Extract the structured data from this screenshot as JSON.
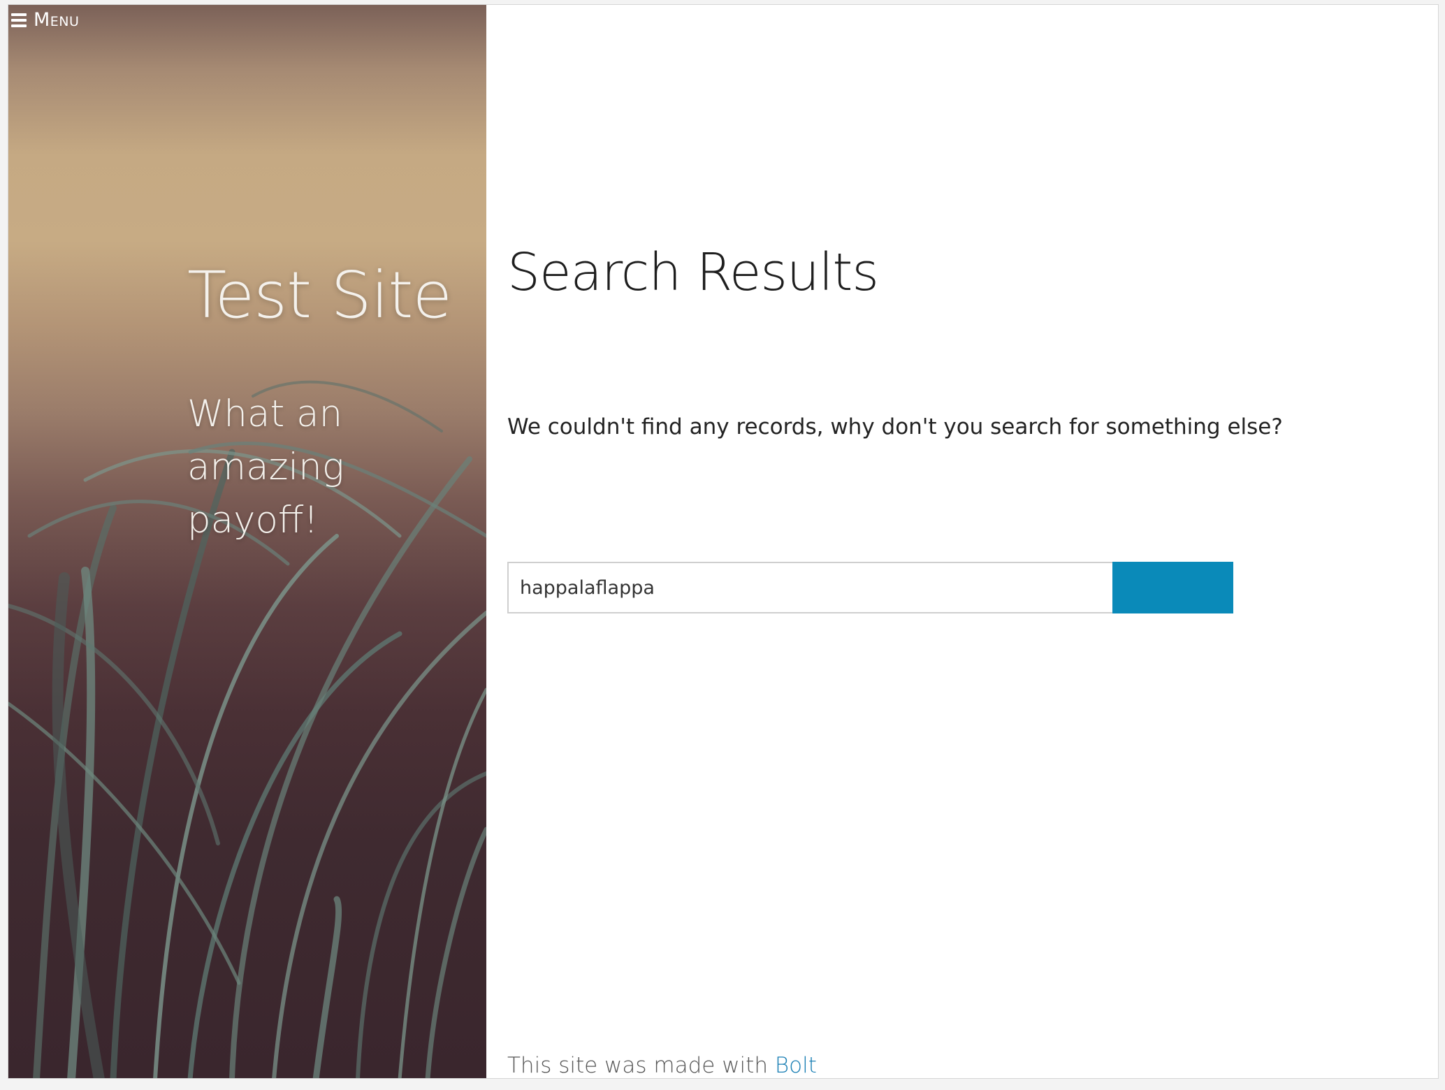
{
  "menu": {
    "icon": "hamburger-icon",
    "label": "Menu"
  },
  "hero": {
    "title": "Test Site",
    "payoff": "What an amazing payoff!"
  },
  "main": {
    "title": "Search Results",
    "message": "We couldn't find any records, why don't you search for something else?"
  },
  "search": {
    "value": "happalaflappa",
    "button_label": "",
    "button_color": "#0a8ab9"
  },
  "footer": {
    "text": "This site was made with ",
    "link_label": "Bolt",
    "link_color": "#1a7fb4"
  }
}
